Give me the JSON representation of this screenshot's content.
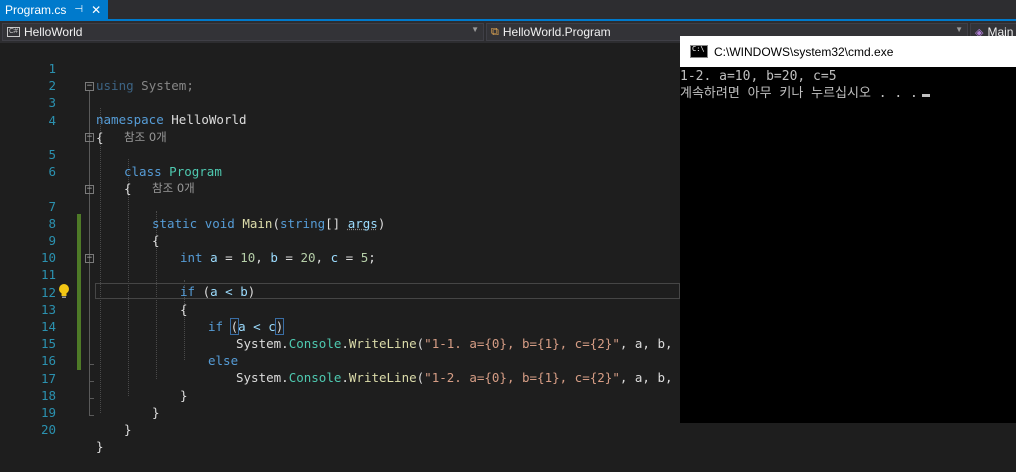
{
  "tab": {
    "title": "Program.cs",
    "pin": "⊣",
    "close": "✕"
  },
  "nav": {
    "project": "HelloWorld",
    "cls": "HelloWorld.Program",
    "member": "Main",
    "cs_badge": "C#"
  },
  "editor": {
    "line_numbers": [
      "1",
      "2",
      "3",
      "4",
      "",
      "5",
      "6",
      "",
      "7",
      "8",
      "9",
      "10",
      "11",
      "12",
      "13",
      "14",
      "15",
      "16",
      "17",
      "18",
      "19",
      "20"
    ],
    "ref_hint": "참조 0개",
    "kw_using": "using",
    "ns_system": "System",
    "semi": ";",
    "kw_namespace": "namespace",
    "ns_name": "HelloWorld",
    "brace_open": "{",
    "brace_close": "}",
    "kw_class": "class",
    "class_name": "Program",
    "kw_static": "static",
    "kw_void": "void",
    "method_main": "Main",
    "paren_open": "(",
    "kw_string": "string",
    "array_suffix": "[] ",
    "param_args": "args",
    "paren_close": ")",
    "kw_int": "int",
    "var_a": "a",
    "var_b": "b",
    "var_c": "c",
    "eq": " = ",
    "num_10": "10",
    "num_20": "20",
    "num_5": "5",
    "comma": ", ",
    "kw_if": "if",
    "kw_else": "else",
    "cond_ab": "a < b",
    "cond_ac": "a < c",
    "cls_system": "System",
    "dot": ".",
    "cls_console": "Console",
    "method_writeline": "WriteLine",
    "str_1_1": "\"1-1. a={0}, b={1}, c={2}\"",
    "str_1_2": "\"1-2. a={0}, b={1}, c={2}\"",
    "args_tail": ", a, b, c);"
  },
  "cmd": {
    "title": "C:\\WINDOWS\\system32\\cmd.exe",
    "output_line1": "1-2. a=10, b=20, c=5",
    "output_line2": "계속하려면 아무 키나 누르십시오 . . ."
  },
  "colors": {
    "accent": "#007acc",
    "keyword": "#569cd6",
    "type": "#4ec9b0",
    "string": "#d69d85",
    "linenumber": "#2b91af"
  }
}
